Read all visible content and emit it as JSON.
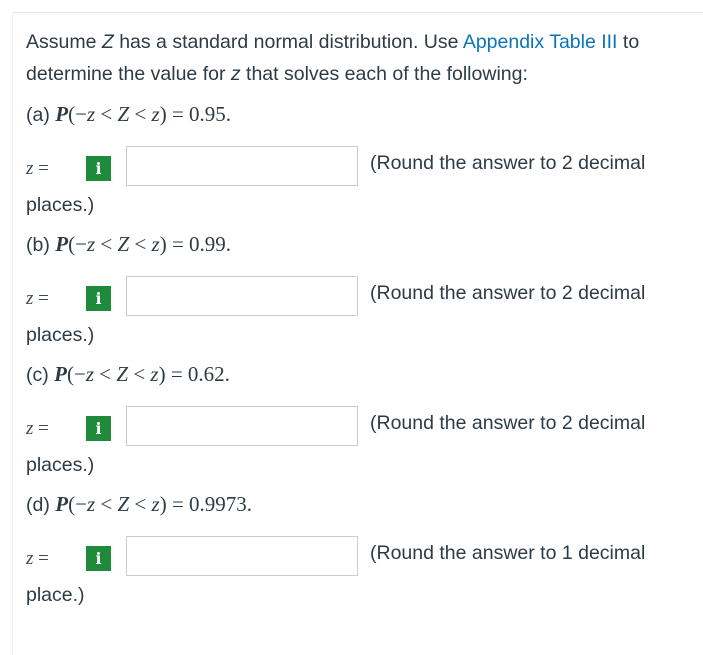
{
  "intro": {
    "text_before_var": "Assume ",
    "var": "Z",
    "text_middle": " has a standard normal distribution. Use ",
    "link_label": "Appendix Table III",
    "text_after_link": " to determine the value for ",
    "var2": "z",
    "text_end": " that solves each of the following:"
  },
  "parts": [
    {
      "label": "(a)",
      "expr_prefix": "P",
      "expr_open": "(−",
      "expr_z1": "z",
      "expr_lt1": " < ",
      "expr_Z": "Z",
      "expr_lt2": " < ",
      "expr_z2": "z",
      "expr_close": ")",
      "expr_value": " = 0.95.",
      "z_label": "z",
      "eq": " =",
      "info_icon": "i",
      "input_value": "",
      "round_note": "(Round the answer to 2 decimal",
      "places": "places.)"
    },
    {
      "label": "(b)",
      "expr_prefix": "P",
      "expr_open": "(−",
      "expr_z1": "z",
      "expr_lt1": " < ",
      "expr_Z": "Z",
      "expr_lt2": " < ",
      "expr_z2": "z",
      "expr_close": ")",
      "expr_value": " = 0.99.",
      "z_label": "z",
      "eq": " =",
      "info_icon": "i",
      "input_value": "",
      "round_note": "(Round the answer to 2 decimal",
      "places": "places.)"
    },
    {
      "label": "(c)",
      "expr_prefix": "P",
      "expr_open": "(−",
      "expr_z1": "z",
      "expr_lt1": " < ",
      "expr_Z": "Z",
      "expr_lt2": " < ",
      "expr_z2": "z",
      "expr_close": ")",
      "expr_value": " = 0.62.",
      "z_label": "z",
      "eq": " =",
      "info_icon": "i",
      "input_value": "",
      "round_note": "(Round the answer to 2 decimal",
      "places": "places.)"
    },
    {
      "label": "(d)",
      "expr_prefix": "P",
      "expr_open": "(−",
      "expr_z1": "z",
      "expr_lt1": " < ",
      "expr_Z": "Z",
      "expr_lt2": " < ",
      "expr_z2": "z",
      "expr_close": ")",
      "expr_value": " = 0.9973.",
      "z_label": "z",
      "eq": " =",
      "info_icon": "i",
      "input_value": "",
      "round_note": "(Round the answer to 1 decimal",
      "places": "place.)"
    }
  ],
  "colors": {
    "text": "#2d3b45",
    "link": "#0b74b8",
    "info_badge": "#1f8a3a",
    "input_border": "#c7cdd1"
  }
}
